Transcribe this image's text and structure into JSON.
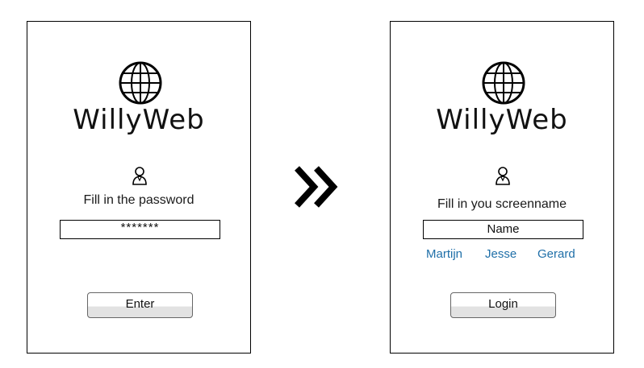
{
  "left_screen": {
    "app_name": "WillyWeb",
    "prompt": "Fill in the password",
    "password_value": "*******",
    "button_label": "Enter"
  },
  "right_screen": {
    "app_name": "WillyWeb",
    "prompt": "Fill in you screenname",
    "name_placeholder": "Name",
    "name_suggestions": [
      "Martijn",
      "Jesse",
      "Gerard"
    ],
    "button_label": "Login"
  },
  "colors": {
    "link": "#1f6fa8",
    "border": "#000000",
    "button_bottom": "#e2e2e2"
  },
  "icons": [
    "globe-icon",
    "user-icon",
    "double-chevron-right-icon"
  ]
}
